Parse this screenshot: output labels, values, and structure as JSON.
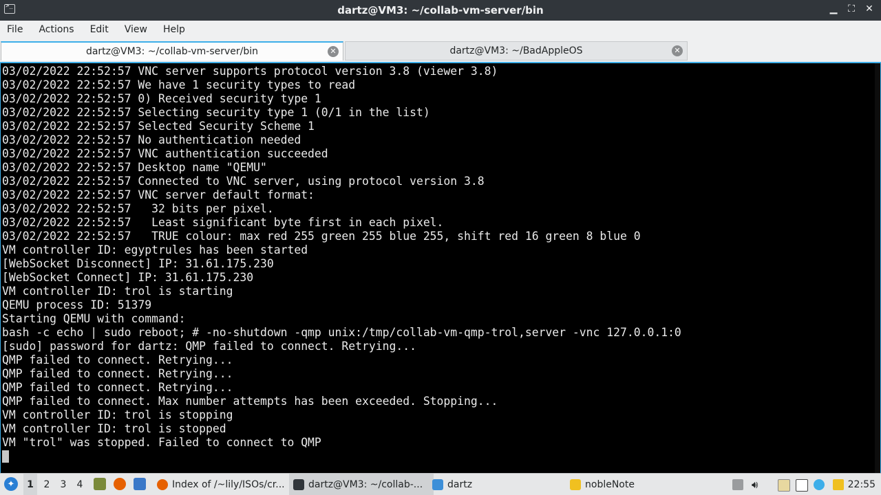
{
  "window": {
    "title": "dartz@VM3: ~/collab-vm-server/bin",
    "minimize_glyph": "▁",
    "maximize_glyph": "⛶",
    "close_glyph": "✕"
  },
  "menu": [
    "File",
    "Actions",
    "Edit",
    "View",
    "Help"
  ],
  "tabs": [
    {
      "label": "dartz@VM3: ~/collab-vm-server/bin",
      "active": true
    },
    {
      "label": "dartz@VM3: ~/BadAppleOS",
      "active": false
    }
  ],
  "terminal": {
    "lines": [
      "03/02/2022 22:52:57 VNC server supports protocol version 3.8 (viewer 3.8)",
      "03/02/2022 22:52:57 We have 1 security types to read",
      "03/02/2022 22:52:57 0) Received security type 1",
      "03/02/2022 22:52:57 Selecting security type 1 (0/1 in the list)",
      "03/02/2022 22:52:57 Selected Security Scheme 1",
      "03/02/2022 22:52:57 No authentication needed",
      "03/02/2022 22:52:57 VNC authentication succeeded",
      "03/02/2022 22:52:57 Desktop name \"QEMU\"",
      "03/02/2022 22:52:57 Connected to VNC server, using protocol version 3.8",
      "03/02/2022 22:52:57 VNC server default format:",
      "03/02/2022 22:52:57   32 bits per pixel.",
      "03/02/2022 22:52:57   Least significant byte first in each pixel.",
      "03/02/2022 22:52:57   TRUE colour: max red 255 green 255 blue 255, shift red 16 green 8 blue 0",
      "VM controller ID: egyptrules has been started",
      "[WebSocket Disconnect] IP: 31.61.175.230",
      "[WebSocket Connect] IP: 31.61.175.230",
      "VM controller ID: trol is starting",
      "QEMU process ID: 51379",
      "Starting QEMU with command:",
      "bash -c echo | sudo reboot; # -no-shutdown -qmp unix:/tmp/collab-vm-qmp-trol,server -vnc 127.0.0.1:0",
      "[sudo] password for dartz: QMP failed to connect. Retrying...",
      "QMP failed to connect. Retrying...",
      "QMP failed to connect. Retrying...",
      "QMP failed to connect. Retrying...",
      "QMP failed to connect. Max number attempts has been exceeded. Stopping...",
      "VM controller ID: trol is stopping",
      "VM controller ID: trol is stopped",
      "VM \"trol\" was stopped. Failed to connect to QMP"
    ]
  },
  "taskbar": {
    "desktops": [
      "1",
      "2",
      "3",
      "4"
    ],
    "active_desktop": "1",
    "tasks": [
      {
        "label": "Index of /~lily/ISOs/cr...",
        "icon": "firefox-icon",
        "color": "#e66000"
      },
      {
        "label": "dartz@VM3: ~/collab-...",
        "icon": "terminal-icon",
        "color": "#31363b",
        "active": true
      },
      {
        "label": "dartz",
        "icon": "folder-icon",
        "color": "#3d8fd8"
      },
      {
        "label": "nobleNote",
        "icon": "notes-icon",
        "color": "#f0c020"
      }
    ],
    "clock": "22:55"
  },
  "colors": {
    "accent": "#3daee9",
    "terminal_bg": "#000000",
    "terminal_fg": "#eaeaea"
  }
}
